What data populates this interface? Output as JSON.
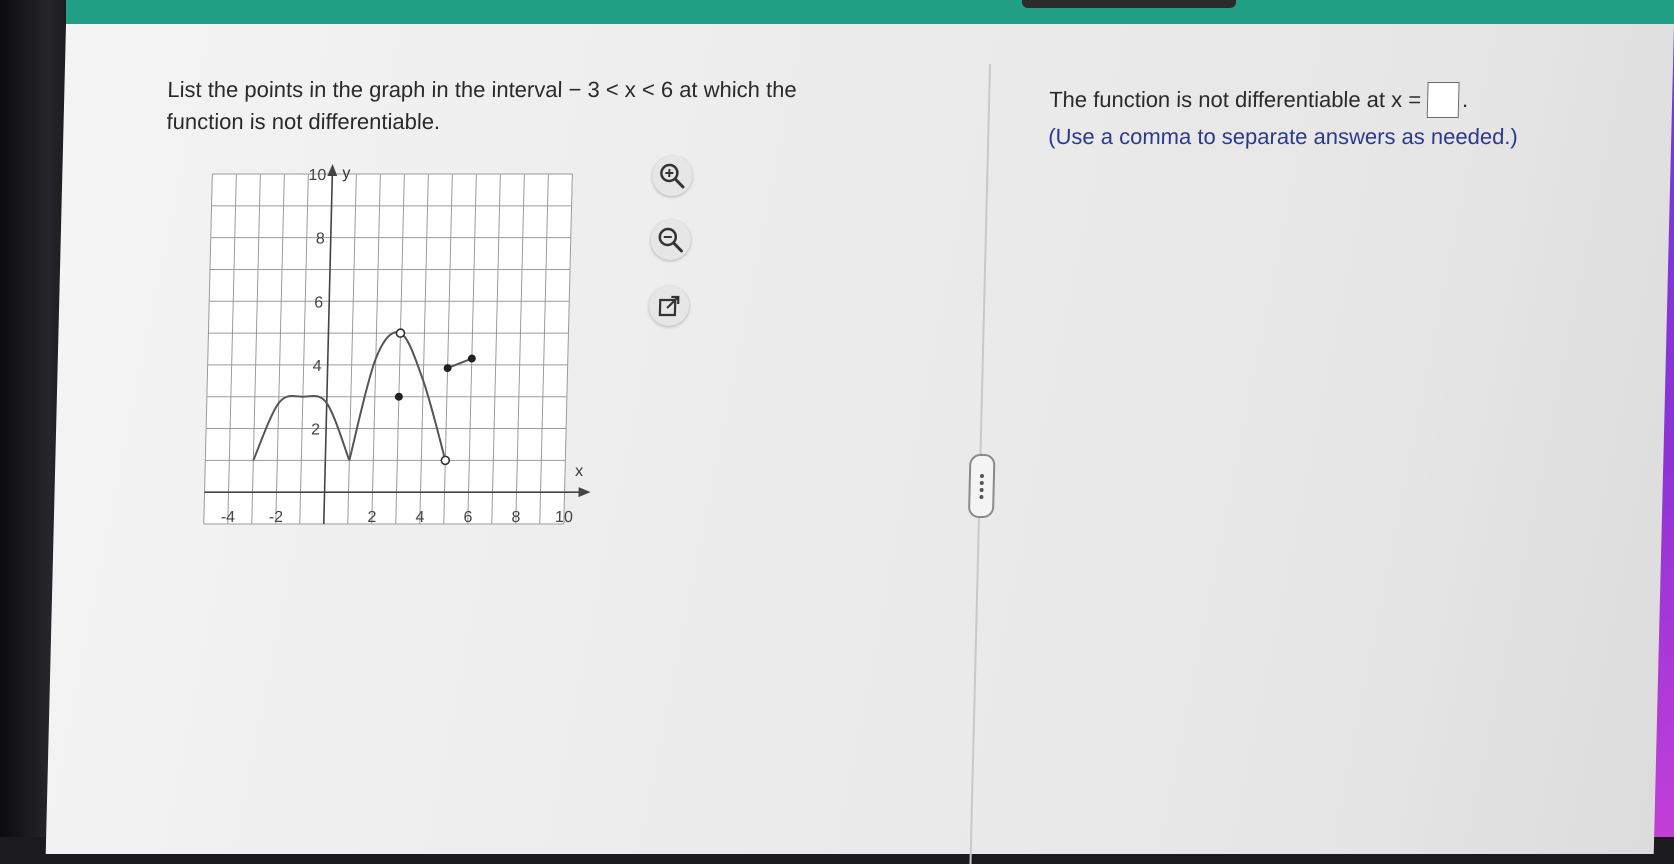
{
  "question": {
    "text_1": "List the points in the graph in the interval",
    "interval": "− 3 < x < 6",
    "text_2": "at which the",
    "text_3": "function is not differentiable."
  },
  "graph": {
    "y_label": "y",
    "x_label": "x",
    "x_ticks": [
      "-4",
      "-2",
      "2",
      "4",
      "6",
      "8",
      "10"
    ],
    "y_ticks": [
      "10",
      "8",
      "6",
      "4",
      "2"
    ]
  },
  "chart_data": {
    "type": "line",
    "xlabel": "x",
    "ylabel": "y",
    "xlim": [
      -5,
      10
    ],
    "ylim": [
      -1,
      10
    ],
    "x_ticks": [
      -4,
      -2,
      2,
      4,
      6,
      8,
      10
    ],
    "y_ticks": [
      2,
      4,
      6,
      8,
      10
    ],
    "grid": true,
    "segments": [
      {
        "kind": "curve",
        "points": [
          [
            -3,
            1
          ],
          [
            -2,
            2.8
          ],
          [
            -1,
            3
          ],
          [
            0,
            2.8
          ],
          [
            1,
            1
          ]
        ]
      },
      {
        "kind": "curve",
        "points": [
          [
            1,
            1
          ],
          [
            2,
            4.2
          ],
          [
            3,
            5
          ],
          [
            4,
            3.5
          ],
          [
            5,
            1
          ]
        ]
      },
      {
        "kind": "line",
        "points": [
          [
            5,
            3.9
          ],
          [
            6,
            4.2
          ]
        ]
      }
    ],
    "open_points": [
      [
        3,
        5
      ],
      [
        5,
        1
      ]
    ],
    "closed_points": [
      [
        3,
        3
      ],
      [
        5,
        3.9
      ],
      [
        6,
        4.2
      ]
    ]
  },
  "tools": {
    "zoom_in": "zoom-in-icon",
    "zoom_out": "zoom-out-icon",
    "popout": "external-link-icon"
  },
  "answer": {
    "prefix": "The function is not differentiable at x =",
    "value": "",
    "suffix": ".",
    "hint": "(Use a comma to separate answers as needed.)"
  },
  "colors": {
    "header": "#22a086",
    "hint": "#2d3a8c",
    "curve": "#555555"
  }
}
